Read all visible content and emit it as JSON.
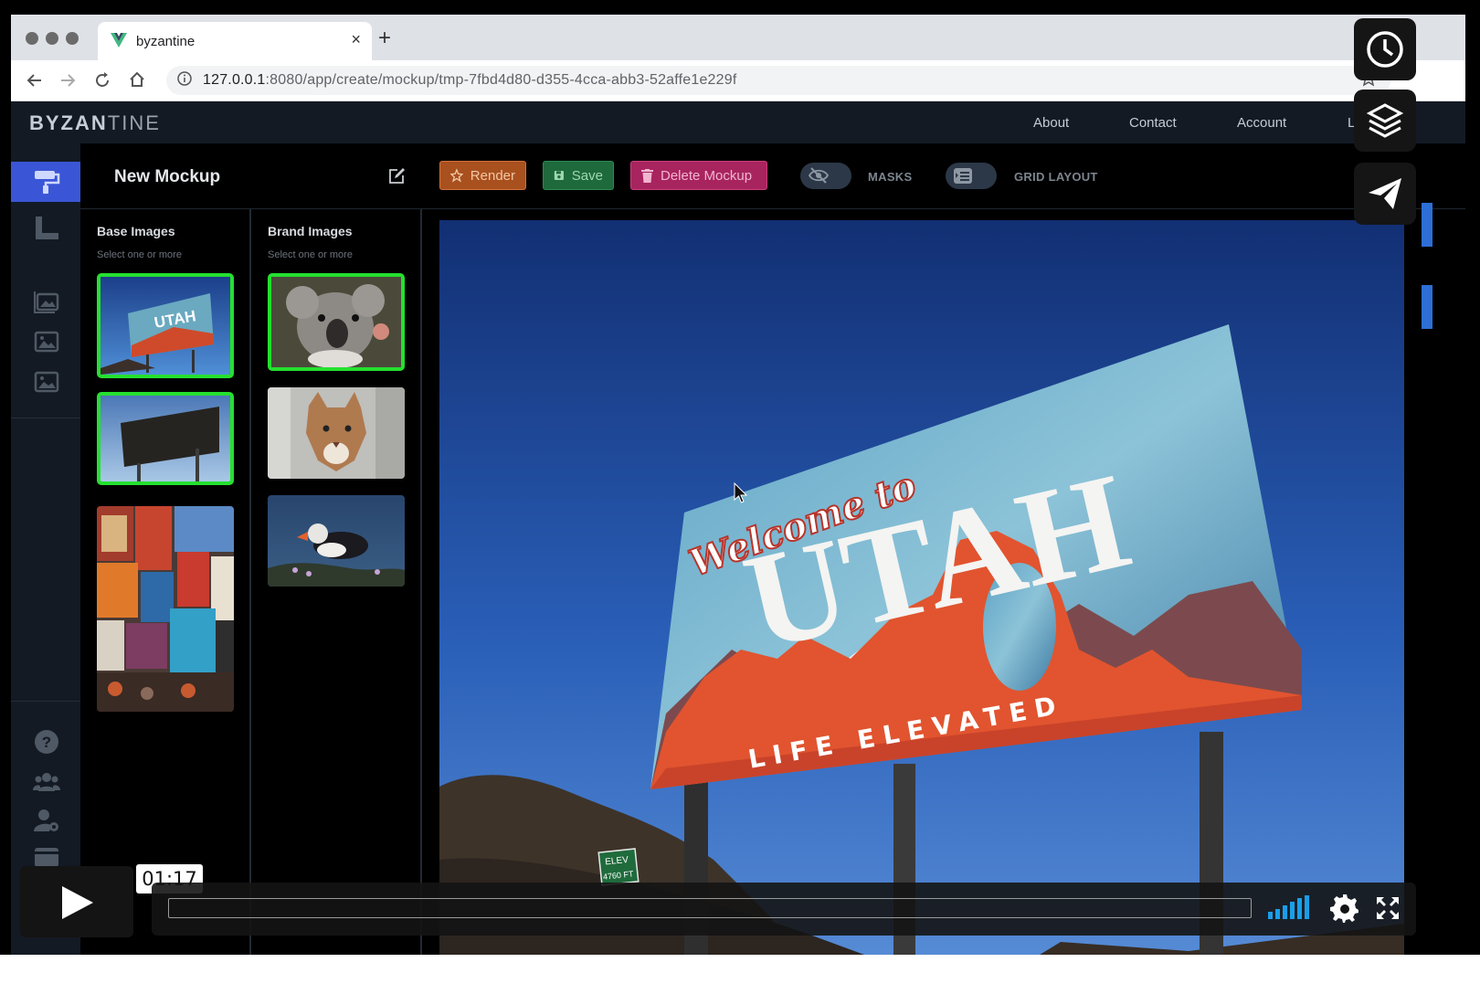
{
  "browser": {
    "tab_title": "byzantine",
    "tab_close": "×",
    "new_tab": "+",
    "url_host": "127.0.0.1",
    "url_rest": ":8080/app/create/mockup/tmp-7fbd4d80-d355-4cca-abb3-52affe1e229f"
  },
  "app": {
    "logo_bold": "BYZAN",
    "logo_light": "TINE",
    "nav": {
      "about": "About",
      "contact": "Contact",
      "account": "Account",
      "logout": "Lo"
    }
  },
  "editor": {
    "title": "New Mockup",
    "render_label": "Render",
    "save_label": "Save",
    "delete_label": "Delete Mockup",
    "masks_label": "MASKS",
    "grid_label": "GRID LAYOUT"
  },
  "base_images": {
    "heading": "Base Images",
    "sub": "Select one or more"
  },
  "brand_images": {
    "heading": "Brand Images",
    "sub": "Select one or more"
  },
  "sign": {
    "welcome": "Welcome to",
    "state": "UTAH",
    "tagline": "LIFE ELEVATED",
    "elev1": "ELEV",
    "elev2": "4760 FT"
  },
  "player": {
    "time": "01:17",
    "progress": 0.0
  },
  "colors": {
    "accent": "#3a56d6",
    "selected": "#25e02f",
    "render": "#a9501f",
    "save": "#1e6a3c",
    "delete": "#a8245f"
  }
}
